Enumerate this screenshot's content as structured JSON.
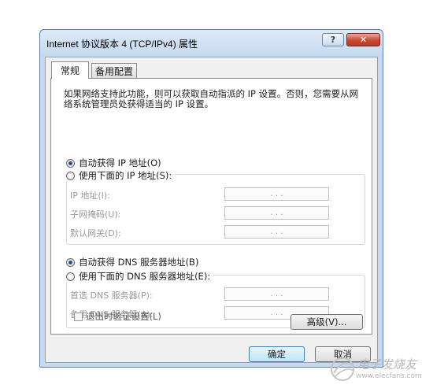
{
  "window": {
    "title": "Internet 协议版本 4 (TCP/IPv4) 属性",
    "help_label": "?",
    "close_label": "✕"
  },
  "tabs": [
    {
      "label": "常规",
      "active": true
    },
    {
      "label": "备用配置",
      "active": false
    }
  ],
  "description": "如果网络支持此功能，则可以获取自动指派的 IP 设置。否则，您需要从网络系统管理员处获得适当的 IP 设置。",
  "ip_section": {
    "auto_label": "自动获得 IP 地址(O)",
    "manual_label": "使用下面的 IP 地址(S):",
    "selected": "auto",
    "fields": [
      {
        "label": "IP 地址(I):",
        "value": ".   .   ."
      },
      {
        "label": "子网掩码(U):",
        "value": ".   .   ."
      },
      {
        "label": "默认网关(D):",
        "value": ".   .   ."
      }
    ]
  },
  "dns_section": {
    "auto_label": "自动获得 DNS 服务器地址(B)",
    "manual_label": "使用下面的 DNS 服务器地址(E):",
    "selected": "auto",
    "fields": [
      {
        "label": "首选 DNS 服务器(P):",
        "value": ".   .   ."
      },
      {
        "label": "备用 DNS 服务器(A):",
        "value": ".   .   ."
      }
    ]
  },
  "validate_checkbox": {
    "label": "退出时验证设置(L)",
    "checked": false
  },
  "buttons": {
    "advanced": "高级(V)...",
    "ok": "确定",
    "cancel": "取消"
  },
  "watermark": {
    "text": "电子发烧友",
    "url": "www.elecfans.com"
  },
  "colors": {
    "title_bar": "#c6d9f0",
    "close_button": "#c84a35",
    "ok_button_border": "#3c7fb1",
    "disabled_text": "#9a9a9a"
  }
}
